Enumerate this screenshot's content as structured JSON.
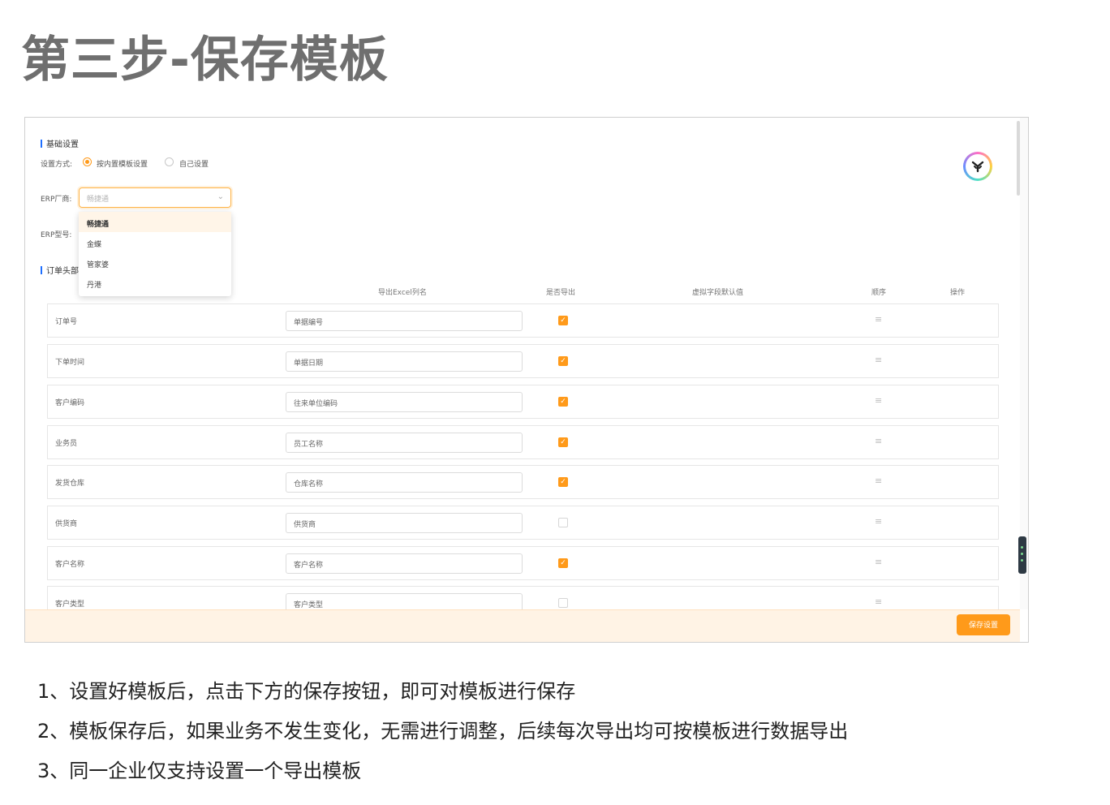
{
  "page_title": "第三步-保存模板",
  "form": {
    "basic_section": "基础设置",
    "setting_mode_label": "设置方式:",
    "radio_options": [
      {
        "label": "按内置模板设置",
        "selected": true
      },
      {
        "label": "自己设置",
        "selected": false
      }
    ],
    "erp_vendor_label": "ERP厂商:",
    "erp_vendor_placeholder": "畅捷通",
    "erp_vendor_options": [
      "畅捷通",
      "金蝶",
      "管家婆",
      "丹港"
    ],
    "erp_model_label": "ERP型号:",
    "order_header_section": "订单头部",
    "columns": {
      "export_col": "导出Excel列名",
      "is_export": "是否导出",
      "virtual_default": "虚拟字段默认值",
      "order": "顺序",
      "action": "操作"
    },
    "rows": [
      {
        "field": "订单号",
        "excel": "单据编号",
        "export": true
      },
      {
        "field": "下单时间",
        "excel": "单据日期",
        "export": true
      },
      {
        "field": "客户编码",
        "excel": "往来单位编码",
        "export": true
      },
      {
        "field": "业务员",
        "excel": "员工名称",
        "export": true
      },
      {
        "field": "发货仓库",
        "excel": "仓库名称",
        "export": true
      },
      {
        "field": "供货商",
        "excel": "供货商",
        "export": false
      },
      {
        "field": "客户名称",
        "excel": "客户名称",
        "export": true
      },
      {
        "field": "客户类型",
        "excel": "客户类型",
        "export": false
      }
    ],
    "save_button": "保存设置",
    "accent_color": "#ff9a1a",
    "section_bar_color": "#1f6fff"
  },
  "notes": [
    "1、设置好模板后，点击下方的保存按钮，即可对模板进行保存",
    "2、模板保存后，如果业务不发生变化，无需进行调整，后续每次导出均可按模板进行数据导出",
    "3、同一企业仅支持设置一个导出模板"
  ]
}
